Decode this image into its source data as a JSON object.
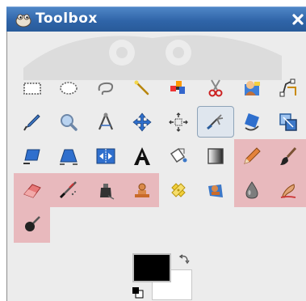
{
  "window": {
    "title": "Toolbox"
  },
  "colors": {
    "titlebar_bg": "#2f64a8",
    "highlight": "#e8b9bd",
    "foreground_color": "#000000",
    "background_color": "#ffffff"
  },
  "tools": [
    {
      "row": 0,
      "col": 0,
      "icon": "rect-select-icon"
    },
    {
      "row": 0,
      "col": 1,
      "icon": "ellipse-select-icon"
    },
    {
      "row": 0,
      "col": 2,
      "icon": "free-select-icon"
    },
    {
      "row": 0,
      "col": 3,
      "icon": "fuzzy-select-icon"
    },
    {
      "row": 0,
      "col": 4,
      "icon": "select-by-color-icon"
    },
    {
      "row": 0,
      "col": 5,
      "icon": "scissors-select-icon"
    },
    {
      "row": 0,
      "col": 6,
      "icon": "foreground-select-icon"
    },
    {
      "row": 0,
      "col": 7,
      "icon": "paths-icon"
    },
    {
      "row": 1,
      "col": 0,
      "icon": "color-picker-icon"
    },
    {
      "row": 1,
      "col": 1,
      "icon": "zoom-icon"
    },
    {
      "row": 1,
      "col": 2,
      "icon": "measure-icon"
    },
    {
      "row": 1,
      "col": 3,
      "icon": "move-icon"
    },
    {
      "row": 1,
      "col": 4,
      "icon": "align-icon"
    },
    {
      "row": 1,
      "col": 5,
      "icon": "crop-icon",
      "selected": true
    },
    {
      "row": 1,
      "col": 6,
      "icon": "rotate-icon"
    },
    {
      "row": 1,
      "col": 7,
      "icon": "scale-icon"
    },
    {
      "row": 2,
      "col": 0,
      "icon": "shear-icon"
    },
    {
      "row": 2,
      "col": 1,
      "icon": "perspective-icon"
    },
    {
      "row": 2,
      "col": 2,
      "icon": "flip-icon"
    },
    {
      "row": 2,
      "col": 3,
      "icon": "text-icon"
    },
    {
      "row": 2,
      "col": 4,
      "icon": "bucket-fill-icon"
    },
    {
      "row": 2,
      "col": 5,
      "icon": "blend-icon"
    },
    {
      "row": 2,
      "col": 6,
      "icon": "pencil-icon",
      "highlighted": true
    },
    {
      "row": 2,
      "col": 7,
      "icon": "paintbrush-icon",
      "highlighted": true
    },
    {
      "row": 3,
      "col": 0,
      "icon": "eraser-icon",
      "highlighted": true
    },
    {
      "row": 3,
      "col": 1,
      "icon": "airbrush-icon",
      "highlighted": true
    },
    {
      "row": 3,
      "col": 2,
      "icon": "ink-icon",
      "highlighted": true
    },
    {
      "row": 3,
      "col": 3,
      "icon": "clone-icon",
      "highlighted": true
    },
    {
      "row": 3,
      "col": 4,
      "icon": "heal-icon"
    },
    {
      "row": 3,
      "col": 5,
      "icon": "perspective-clone-icon"
    },
    {
      "row": 3,
      "col": 6,
      "icon": "blur-icon",
      "highlighted": true
    },
    {
      "row": 3,
      "col": 7,
      "icon": "smudge-icon",
      "highlighted": true
    },
    {
      "row": 4,
      "col": 0,
      "icon": "dodge-burn-icon",
      "highlighted": true
    }
  ]
}
